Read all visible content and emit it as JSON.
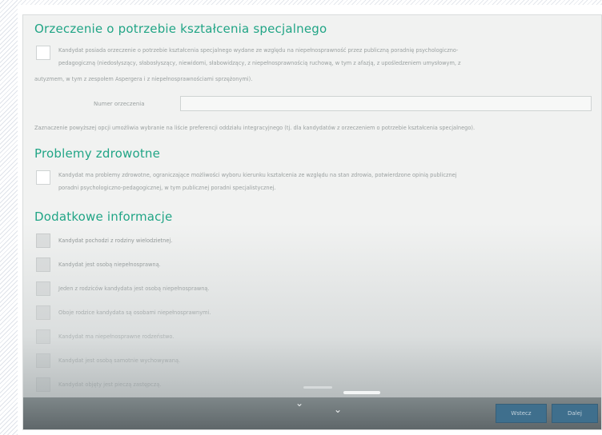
{
  "sections": {
    "orzeczenie": {
      "title": "Orzeczenie o potrzebie kształcenia specjalnego",
      "text_lines": [
        "Kandydat posiada orzeczenie o potrzebie kształcenia specjalnego wydane ze względu na niepełnosprawność przez publiczną poradnię psychologiczno-",
        "pedagogiczną (niedosłyszący, słabosłyszący, niewidomi, słabowidzący, z niepełnosprawnością ruchową, w tym z afazją, z upośledzeniem umysłowym, z",
        "autyzmem, w tym z zespołem Aspergera i z niepełnosprawnościami sprzężonymi)."
      ],
      "number_label": "Numer orzeczenia",
      "number_value": "",
      "note": "Zaznaczenie powyższej opcji umożliwia wybranie na liście preferencji oddziału integracyjnego (tj. dla kandydatów z orzeczeniem o potrzebie kształcenia specjalnego)."
    },
    "problemy": {
      "title": "Problemy zdrowotne",
      "text_lines": [
        "Kandydat ma problemy zdrowotne, ograniczające możliwości wyboru kierunku kształcenia ze względu na stan zdrowia, potwierdzone opinią publicznej",
        "poradni psychologiczno-pedagogicznej, w tym publicznej poradni specjalistycznej."
      ]
    },
    "dodatkowe": {
      "title": "Dodatkowe informacje",
      "items": [
        "Kandydat pochodzi z rodziny wielodzietnej.",
        "Kandydat jest osobą niepełnosprawną.",
        "Jeden z rodziców kandydata jest osobą niepełnosprawną.",
        "Oboje rodzice kandydata są osobami niepełnosprawnymi.",
        "Kandydat ma niepełnosprawne rodzeństwo.",
        "Kandydat jest osobą samotnie wychowywaną.",
        "Kandydat objęty jest pieczą zastępczą."
      ]
    }
  },
  "footer": {
    "back_label": "Wstecz",
    "next_label": "Dalej"
  },
  "icons": {
    "scroll_down": "chevron-down-icon"
  },
  "colors": {
    "section_title": "#21a586",
    "button": "#3f6f8d",
    "background": "#f1f2f1"
  }
}
